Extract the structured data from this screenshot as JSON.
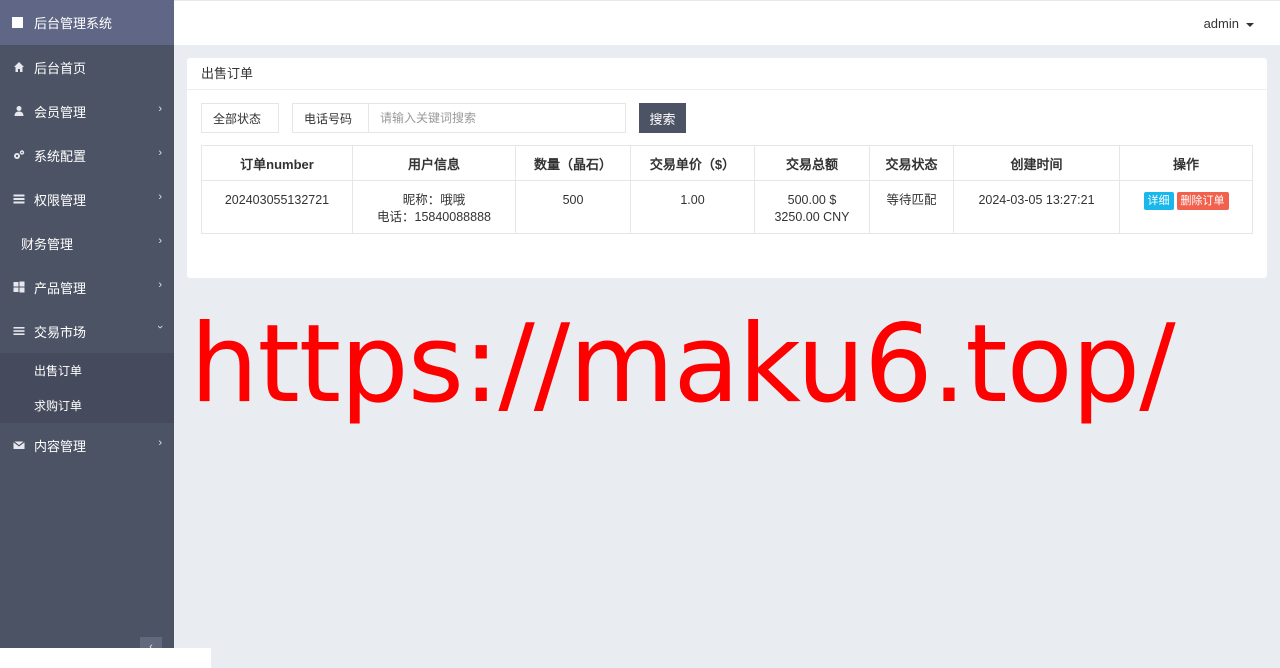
{
  "brand": {
    "title": "后台管理系统"
  },
  "header": {
    "user": "admin"
  },
  "sidebar": {
    "items": [
      {
        "label": "后台首页",
        "icon": "home-icon"
      },
      {
        "label": "会员管理",
        "icon": "user-icon"
      },
      {
        "label": "系统配置",
        "icon": "cogs-icon"
      },
      {
        "label": "权限管理",
        "icon": "list-icon"
      },
      {
        "label": "财务管理",
        "icon": ""
      },
      {
        "label": "产品管理",
        "icon": "windows-icon"
      },
      {
        "label": "交易市场",
        "icon": "bars-icon"
      },
      {
        "label": "内容管理",
        "icon": "envelope-icon"
      }
    ],
    "sub_items": [
      {
        "label": "出售订单"
      },
      {
        "label": "求购订单"
      }
    ],
    "collapse": "‹"
  },
  "panel": {
    "title": "出售订单"
  },
  "filter": {
    "status": "全部状态",
    "field_label": "电话号码",
    "keyword_placeholder": "请输入关键词搜索",
    "search_label": "搜索"
  },
  "table": {
    "headers": [
      "订单number",
      "用户信息",
      "数量（晶石）",
      "交易单价（$）",
      "交易总额",
      "交易状态",
      "创建时间",
      "操作"
    ],
    "rows": [
      {
        "order_no": "202403055132721",
        "nickname": "昵称：哦哦",
        "phone": "电话：15840088888",
        "quantity": "500",
        "price": "1.00",
        "total_usd": "500.00 $",
        "total_cny": "3250.00 CNY",
        "status": "等待匹配",
        "created": "2024-03-05 13:27:21",
        "detail_label": "详细",
        "delete_label": "删除订单"
      }
    ]
  },
  "watermark": "https://maku6.top/"
}
